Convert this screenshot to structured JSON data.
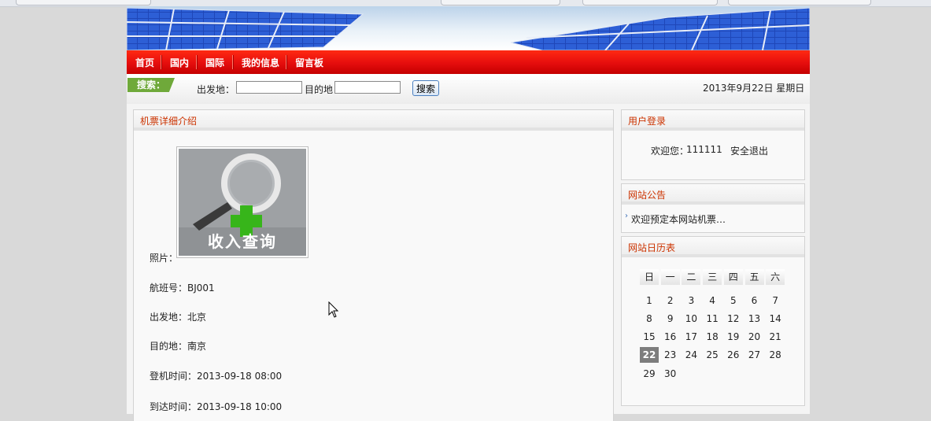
{
  "nav": {
    "items": [
      "首页",
      "国内",
      "国际",
      "我的信息",
      "留言板"
    ]
  },
  "search": {
    "tag": "搜索：",
    "from_label": "出发地：",
    "from_value": "",
    "to_label": "目的地",
    "to_value": "",
    "button": "搜索",
    "date": "2013年9月22日  星期日"
  },
  "detail": {
    "title": "机票详细介绍",
    "photo_label": "照片：",
    "photo_caption": "收入查询",
    "flight_label": "航班号：",
    "flight_value": "BJ001",
    "from_label": "出发地：",
    "from_value": "北京",
    "to_label": "目的地：",
    "to_value": "南京",
    "board_label": "登机时间：",
    "board_value": "2013-09-18 08:00",
    "arrive_label": "到达时间：",
    "arrive_value": "2013-09-18 10:00"
  },
  "login": {
    "title": "用户登录",
    "welcome": "欢迎您：",
    "username": "111111",
    "logout": "安全退出"
  },
  "notice": {
    "title": "网站公告",
    "item": "欢迎预定本网站机票…"
  },
  "calendar": {
    "title": "网站日历表",
    "weekdays": [
      "日",
      "一",
      "二",
      "三",
      "四",
      "五",
      "六"
    ],
    "rows": [
      [
        "",
        "1",
        "2",
        "3",
        "4",
        "5",
        "6",
        "7"
      ],
      [
        "8",
        "9",
        "10",
        "11",
        "12",
        "13",
        "14"
      ],
      [
        "15",
        "16",
        "17",
        "18",
        "19",
        "20",
        "21"
      ],
      [
        "22",
        "23",
        "24",
        "25",
        "26",
        "27",
        "28"
      ],
      [
        "29",
        "30"
      ]
    ],
    "today": "22"
  },
  "colors": {
    "nav_red": "#e50d0d",
    "title_orange": "#cc3300",
    "search_green": "#6fa93a",
    "today_gray": "#7d7d7d"
  }
}
